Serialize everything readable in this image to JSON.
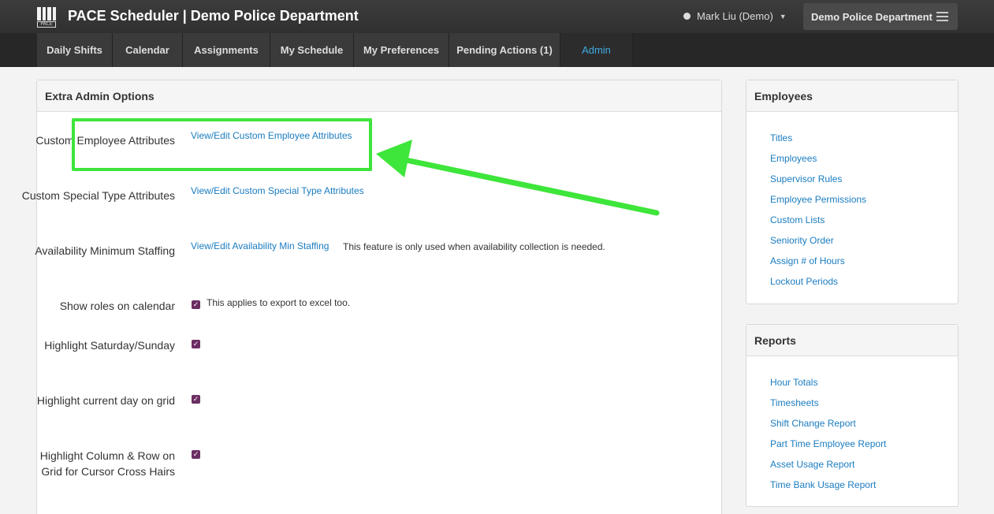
{
  "header": {
    "app_title": "PACE Scheduler | Demo Police Department",
    "logo_text": "PACE",
    "user_name": "Mark Liu (Demo)",
    "department": "Demo Police Department"
  },
  "nav": {
    "tabs": [
      {
        "label": "Daily Shifts"
      },
      {
        "label": "Calendar"
      },
      {
        "label": "Assignments"
      },
      {
        "label": "My Schedule"
      },
      {
        "label": "My Preferences"
      },
      {
        "label": "Pending Actions (1)"
      },
      {
        "label": "Admin",
        "active": true
      }
    ]
  },
  "main": {
    "title": "Extra Admin Options",
    "rows": [
      {
        "label": "Custom Employee Attributes",
        "link": "View/Edit Custom Employee Attributes"
      },
      {
        "label": "Custom Special Type Attributes",
        "link": "View/Edit Custom Special Type Attributes"
      },
      {
        "label": "Availability Minimum Staffing",
        "link": "View/Edit Availability Min Staffing",
        "note": "This feature is only used when availability collection is needed."
      },
      {
        "label": "Show roles on calendar",
        "checked": true,
        "note": "This applies to export to excel too."
      },
      {
        "label": "Highlight Saturday/Sunday",
        "checked": true
      },
      {
        "label": "Highlight current day on grid",
        "checked": true
      },
      {
        "label": "Highlight Column & Row on Grid for Cursor Cross Hairs",
        "checked": true
      }
    ]
  },
  "employees": {
    "title": "Employees",
    "links": [
      "Titles",
      "Employees",
      "Supervisor Rules",
      "Employee Permissions",
      "Custom Lists",
      "Seniority Order",
      "Assign # of Hours",
      "Lockout Periods"
    ]
  },
  "reports": {
    "title": "Reports",
    "links": [
      "Hour Totals",
      "Timesheets",
      "Shift Change Report",
      "Part Time Employee Report",
      "Asset Usage Report",
      "Time Bank Usage Report"
    ]
  },
  "colors": {
    "accent_link": "#1a7cc0",
    "annotation_green": "#3ee53a",
    "checkbox": "#6b2e62",
    "active_tab": "#3fa9e0"
  }
}
